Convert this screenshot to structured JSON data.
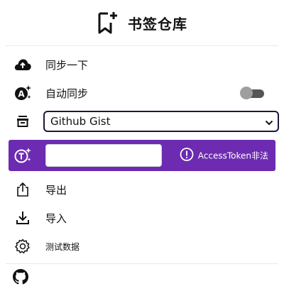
{
  "header": {
    "title": "书签仓库",
    "logo_icon": "bookmark-plus-icon"
  },
  "menu": {
    "sync": {
      "label": "同步一下",
      "icon": "cloud-upload-icon"
    },
    "auto_sync": {
      "label": "自动同步",
      "icon": "auto-sparkle-icon",
      "enabled": false
    },
    "storage": {
      "icon": "archive-icon",
      "selected": "Github Gist"
    },
    "token": {
      "icon": "token-sparkle-icon",
      "value": "",
      "warning": "AccessToken非法",
      "bar_color": "#6c2bb0"
    },
    "export": {
      "label": "导出",
      "icon": "share-export-icon"
    },
    "import": {
      "label": "导入",
      "icon": "download-import-icon"
    },
    "test": {
      "label": "测试数据",
      "icon": "gear-icon"
    }
  },
  "footer": {
    "icon": "github-icon"
  }
}
